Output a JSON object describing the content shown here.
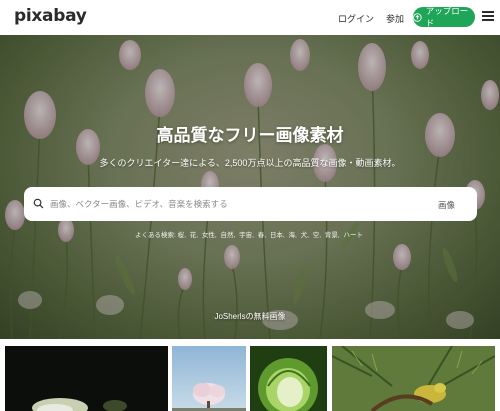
{
  "header": {
    "logo": "pixabay",
    "login": "ログイン",
    "join": "参加",
    "upload": "アップロード"
  },
  "hero": {
    "title": "高品質なフリー画像素材",
    "subtitle": "多くのクリエイター達による、2,500万点以上の高品質な画像・動画素材。",
    "search_placeholder": "画像、ベクター画像、ビデオ、音楽を検索する",
    "search_type": "画像",
    "popular_label": "よくある検索:",
    "popular_tags": [
      "桜,",
      "花,",
      "女性,",
      "自然,",
      "宇宙,",
      "春,",
      "日本,",
      "海,",
      "犬,",
      "空,",
      "背景,",
      "ハート"
    ],
    "credit": "JoSherlsの無料画像"
  },
  "colors": {
    "accent": "#1fa557",
    "header_bg": "#ffffff",
    "text": "#2b2b2b"
  },
  "icons": {
    "upload": "upload-icon",
    "menu": "hamburger-menu-icon",
    "search": "search-icon",
    "chevron": "chevron-down-icon"
  }
}
